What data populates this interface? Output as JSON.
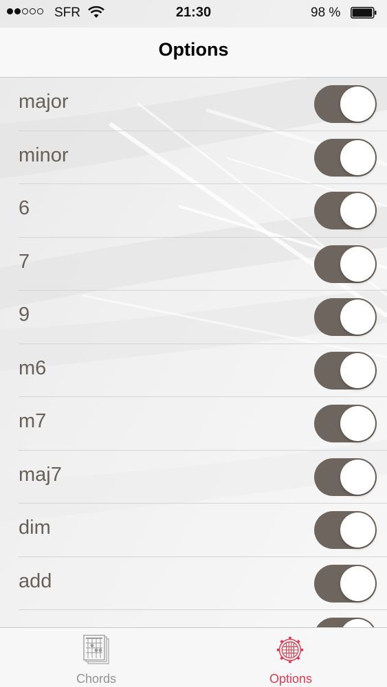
{
  "status_bar": {
    "signal_dots_filled": 2,
    "signal_dots_total": 5,
    "carrier": "SFR",
    "time": "21:30",
    "battery_percent": "98 %",
    "battery_level": 0.98
  },
  "nav": {
    "title": "Options"
  },
  "chord_types": [
    {
      "label": "major",
      "enabled": true
    },
    {
      "label": "minor",
      "enabled": true
    },
    {
      "label": "6",
      "enabled": true
    },
    {
      "label": "7",
      "enabled": true
    },
    {
      "label": "9",
      "enabled": true
    },
    {
      "label": "m6",
      "enabled": true
    },
    {
      "label": "m7",
      "enabled": true
    },
    {
      "label": "maj7",
      "enabled": true
    },
    {
      "label": "dim",
      "enabled": true
    },
    {
      "label": "add",
      "enabled": true
    },
    {
      "label": "",
      "enabled": true
    }
  ],
  "tab_bar": {
    "tabs": [
      {
        "label": "Chords",
        "icon": "chord-chart-icon",
        "active": false
      },
      {
        "label": "Options",
        "icon": "gear-icon",
        "active": true
      }
    ]
  },
  "colors": {
    "toggle_on": "#6e655e",
    "label_text": "#666058",
    "active_tab": "#e03a4e",
    "inactive_tab": "#929292"
  }
}
